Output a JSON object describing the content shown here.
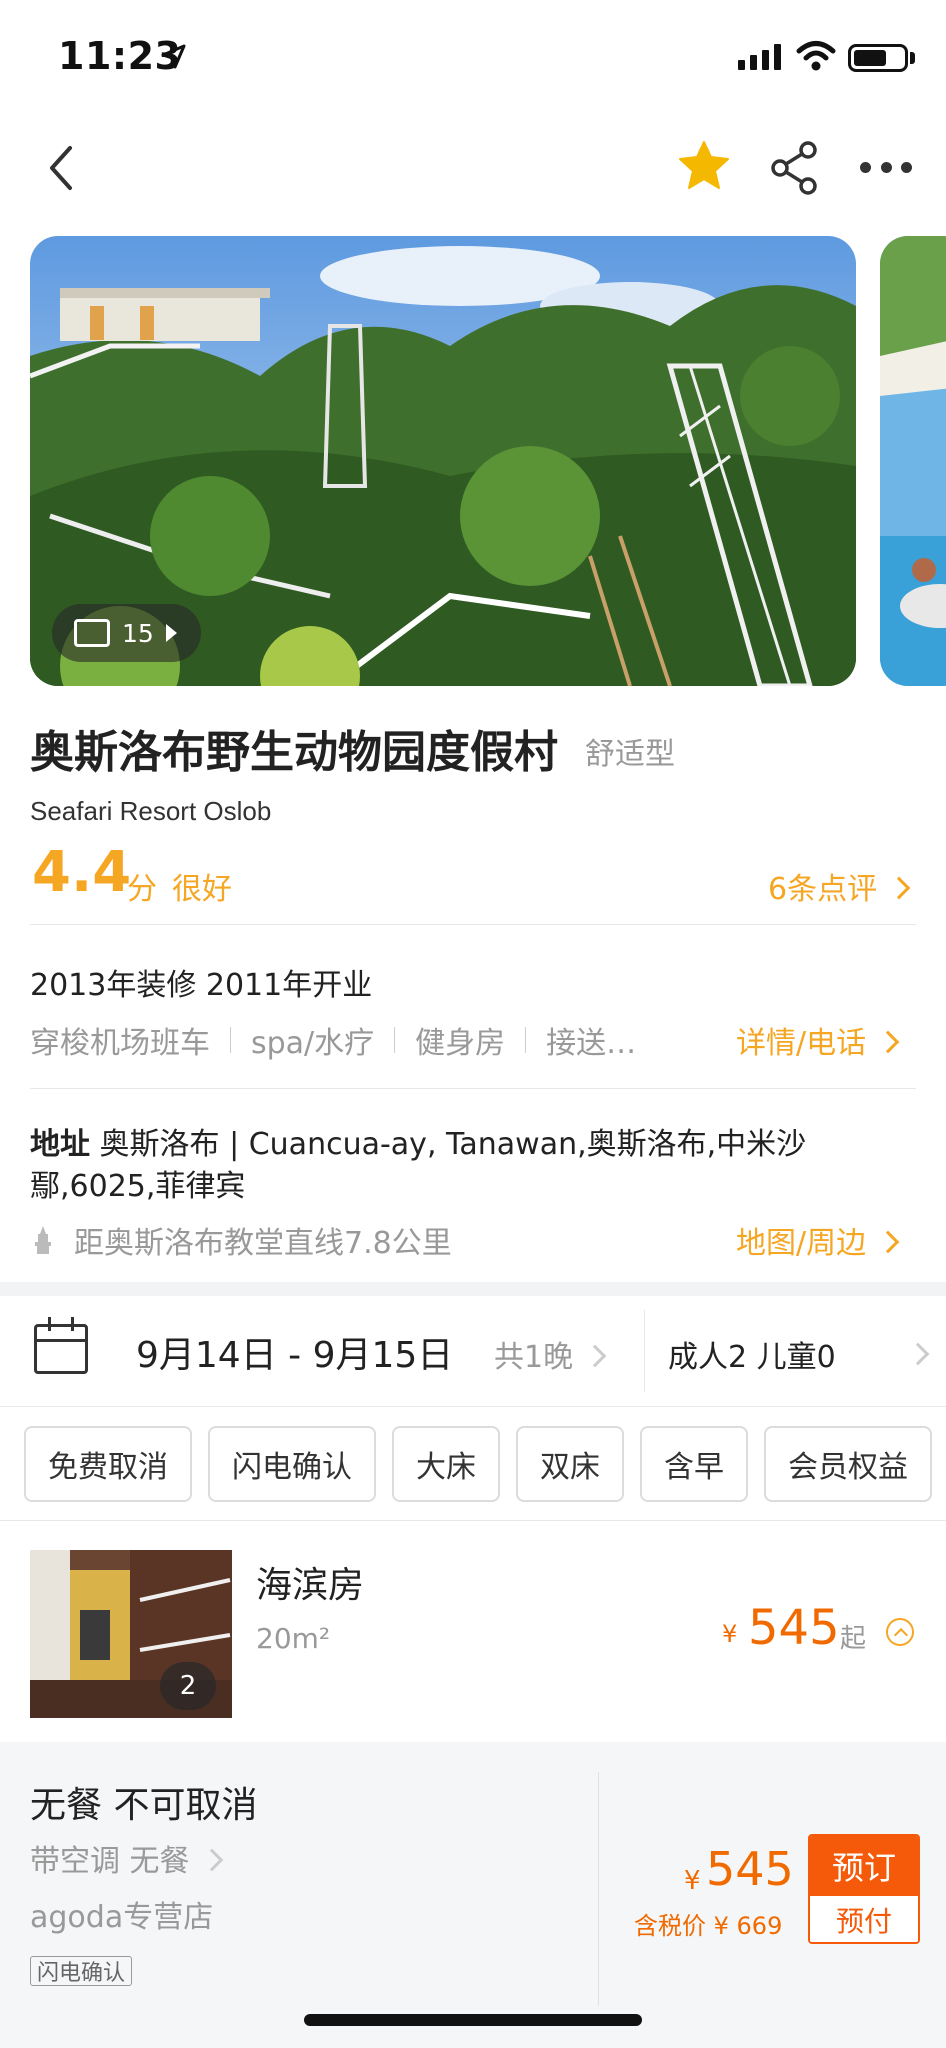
{
  "status_bar": {
    "time": "11:23"
  },
  "nav": {
    "favorite_active": true,
    "accent_color": "#f5b800"
  },
  "gallery": {
    "photo_count": "15"
  },
  "hotel": {
    "name": "奥斯洛布野生动物园度假村",
    "type": "舒适型",
    "english_name": "Seafari Resort Oslob",
    "score": "4.4",
    "score_unit": "分",
    "score_desc": "很好",
    "reviews_link": "6条点评",
    "renovation": "2013年装修 2011年开业",
    "facilities": [
      "穿梭机场班车",
      "spa/水疗",
      "健身房",
      "接送…"
    ],
    "detail_link": "详情/电话",
    "address_label": "地址",
    "address": "奥斯洛布 | Cuancua-ay, Tanawan,奥斯洛布,中米沙鄢,6025,菲律宾",
    "landmark": "距奥斯洛布教堂直线7.8公里",
    "map_link": "地图/周边"
  },
  "booking": {
    "dates": "9月14日 - 9月15日",
    "nights": "共1晚",
    "guests": "成人2 儿童0"
  },
  "filters": [
    "免费取消",
    "闪电确认",
    "大床",
    "双床",
    "含早",
    "会员权益"
  ],
  "room": {
    "name": "海滨房",
    "size": "20m²",
    "image_count": "2",
    "currency": "¥",
    "price": "545",
    "price_suffix": "起"
  },
  "rate_plan": {
    "title": "无餐 不可取消",
    "subtitle": "带空调 无餐",
    "store": "agoda专营店",
    "tag": "闪电确认",
    "currency": "¥",
    "price": "545",
    "tax_price": "含税价 ¥ 669",
    "book_label": "预订",
    "book_sub": "预付"
  },
  "colors": {
    "accent_orange": "#f5a623",
    "price_orange": "#f06a00",
    "book_button": "#f55a0a"
  }
}
